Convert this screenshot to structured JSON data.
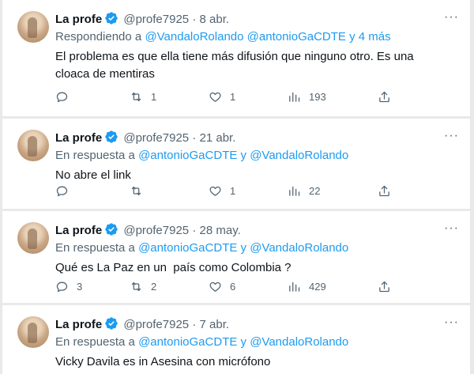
{
  "tweets": [
    {
      "name": "La profe",
      "handle": "@profe7925",
      "date": "8 abr.",
      "reply_prefix": "Respondiendo a ",
      "reply_target_1": "@VandaloRolando",
      "reply_target_2": "@antonioGaCDTE",
      "reply_suffix": "y 4 más",
      "text": "El problema es que ella tiene más difusión que ninguno otro. Es una cloaca de mentiras",
      "replies": "",
      "retweets": "1",
      "likes": "1",
      "views": "193"
    },
    {
      "name": "La profe",
      "handle": "@profe7925",
      "date": "21 abr.",
      "reply_prefix": "En respuesta a ",
      "reply_target_1": "@antonioGaCDTE",
      "reply_join": " y ",
      "reply_target_2": "@VandaloRolando",
      "text": "No abre el link",
      "replies": "",
      "retweets": "",
      "likes": "1",
      "views": "22"
    },
    {
      "name": "La profe",
      "handle": "@profe7925",
      "date": "28 may.",
      "reply_prefix": "En respuesta a ",
      "reply_target_1": "@antonioGaCDTE",
      "reply_join": " y ",
      "reply_target_2": "@VandaloRolando",
      "text": "Qué es La Paz en un  país como Colombia ?",
      "replies": "3",
      "retweets": "2",
      "likes": "6",
      "views": "429"
    },
    {
      "name": "La profe",
      "handle": "@profe7925",
      "date": "7 abr.",
      "reply_prefix": "En respuesta a ",
      "reply_target_1": "@antonioGaCDTE",
      "reply_join": " y ",
      "reply_target_2": "@VandaloRolando",
      "text": "Vicky Davila es in Asesina con micrófono"
    }
  ],
  "separator_dot": "·",
  "more_glyph": "···",
  "colors": {
    "link": "#1d9bf0",
    "muted": "#536471",
    "text": "#0f1419",
    "verified": "#1d9bf0"
  },
  "icons": [
    "avatar",
    "verified-badge-icon",
    "more-options-icon",
    "reply-icon",
    "retweet-icon",
    "like-icon",
    "views-icon",
    "share-icon"
  ]
}
